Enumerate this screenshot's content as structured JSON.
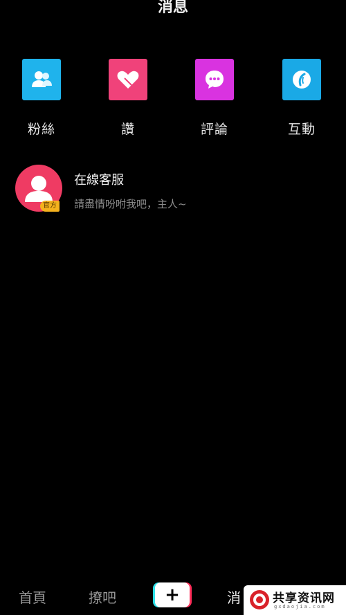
{
  "header": {
    "title": "消息"
  },
  "categories": [
    {
      "label": "粉絲",
      "color": "#1fb3ec",
      "icon": "fans-icon"
    },
    {
      "label": "讚",
      "color": "#f0427a",
      "icon": "heart-icon"
    },
    {
      "label": "評論",
      "color": "#d933e0",
      "icon": "comment-icon"
    },
    {
      "label": "互動",
      "color": "#1aa9e6",
      "icon": "interaction-icon"
    }
  ],
  "messages": [
    {
      "name": "在線客服",
      "preview": "請盡情吩咐我吧，主人~",
      "badge": "官方",
      "avatar": "user-avatar-icon",
      "avatar_color": "#ef3b63"
    }
  ],
  "bottom_nav": {
    "home": "首頁",
    "chat": "撩吧",
    "create": "+",
    "messages": "消"
  },
  "watermark": {
    "title": "共享资讯网",
    "subtitle": "gxdaojia.com"
  }
}
